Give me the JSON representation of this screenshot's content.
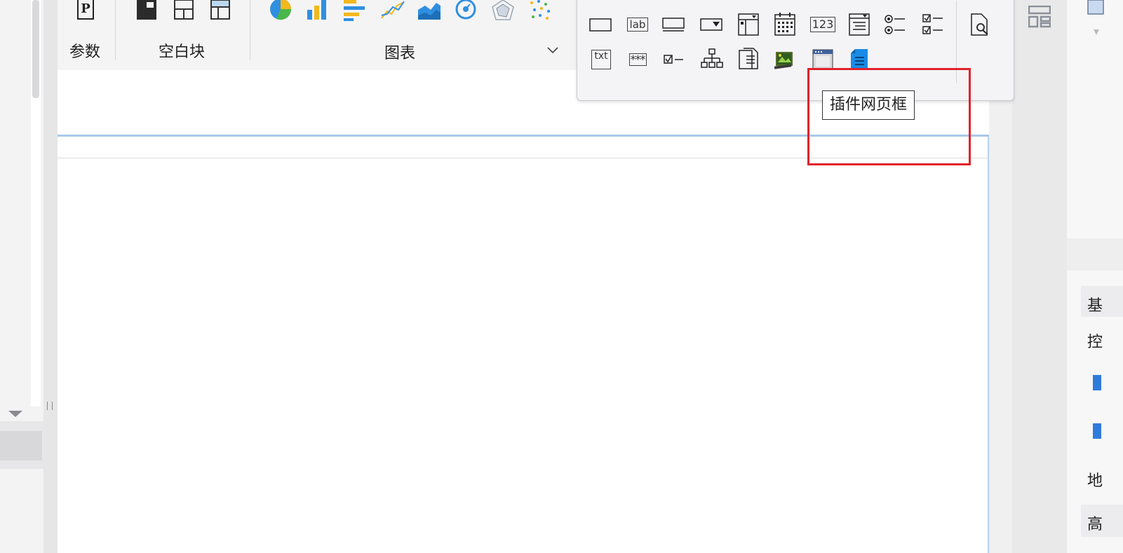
{
  "ribbon": {
    "groups": [
      {
        "label": "参数"
      },
      {
        "label": "空白块"
      },
      {
        "label": "图表"
      }
    ],
    "params_icon": "P",
    "expand_icon": "chevron-down"
  },
  "popup": {
    "row1": [
      "rectangle-icon",
      "label-icon",
      "button-icon",
      "dropdown-icon",
      "layout-panel-icon",
      "calendar-icon",
      "number-icon",
      "list-icon",
      "radio-group-icon",
      "checkbox-group-icon",
      "preview-icon"
    ],
    "row2": [
      "text-field-icon",
      "password-icon",
      "checkbox-icon",
      "tree-icon",
      "document-icon",
      "image-icon",
      "web-frame-icon",
      "file-icon"
    ],
    "label_text": "lab",
    "number_text": "123",
    "txt_text": "txt",
    "password_text": "***"
  },
  "tooltip": {
    "text": "插件网页框"
  },
  "right_panel": {
    "labels": [
      "基",
      "控",
      "地",
      "高"
    ]
  },
  "colors": {
    "highlight_red": "#e1222b",
    "accent_blue": "#2f7bdb"
  }
}
